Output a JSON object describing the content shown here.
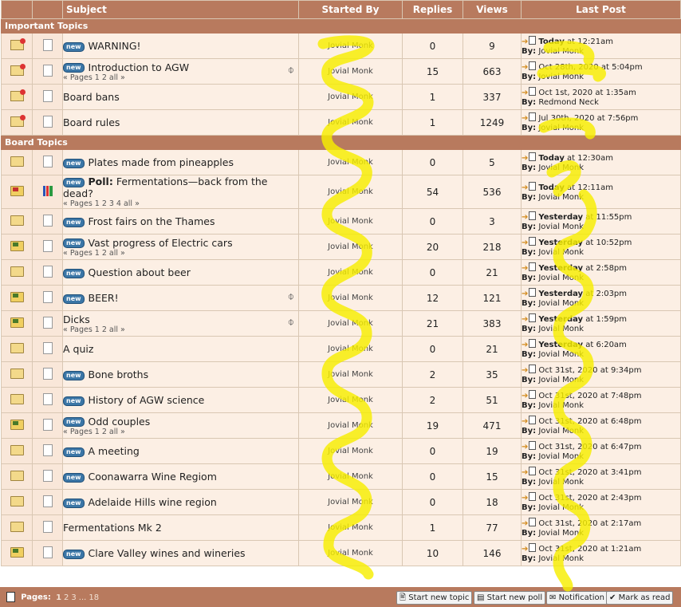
{
  "columns": {
    "subject": "Subject",
    "started_by": "Started By",
    "replies": "Replies",
    "views": "Views",
    "last_post": "Last Post"
  },
  "sections": [
    {
      "title": "Important Topics",
      "topics": [
        {
          "status": "locked",
          "new": true,
          "title": "WARNING!",
          "pages": null,
          "clip": false,
          "starter": "Jovial Monk",
          "replies": "0",
          "views": "9",
          "last_when": "Today",
          "last_rest": " at 12:21am",
          "last_by": "Jovial Monk",
          "when_bold": true
        },
        {
          "status": "locked",
          "new": true,
          "title": "Introduction to AGW",
          "pages": [
            "« Pages",
            "1",
            "2",
            "all",
            "»"
          ],
          "clip": true,
          "starter": "Jovial Monk",
          "replies": "15",
          "views": "663",
          "last_when": "Oct 28th, 2020",
          "last_rest": " at 5:04pm",
          "last_by": "Jovial Monk",
          "when_bold": false
        },
        {
          "status": "locked",
          "new": false,
          "title": "Board bans",
          "pages": null,
          "clip": false,
          "starter": "Jovial Monk",
          "replies": "1",
          "views": "337",
          "last_when": "Oct 1st, 2020",
          "last_rest": " at 1:35am",
          "last_by": "Redmond Neck",
          "when_bold": false
        },
        {
          "status": "locked",
          "new": false,
          "title": "Board rules",
          "pages": null,
          "clip": false,
          "starter": "Jovial Monk",
          "replies": "1",
          "views": "1249",
          "last_when": "Jul 30th, 2020",
          "last_rest": " at 7:56pm",
          "last_by": "Jovial Monk",
          "when_bold": false
        }
      ]
    },
    {
      "title": "Board Topics",
      "topics": [
        {
          "status": "folder",
          "new": true,
          "title": "Plates made from pineapples",
          "pages": null,
          "clip": false,
          "starter": "Jovial Monk",
          "replies": "0",
          "views": "5",
          "last_when": "Today",
          "last_rest": " at 12:30am",
          "last_by": "Jovial Monk",
          "when_bold": true
        },
        {
          "status": "hot-red",
          "poll": true,
          "new": true,
          "title": "Poll: Fermentations—back from the dead?",
          "pages": [
            "« Pages",
            "1",
            "2",
            "3",
            "4",
            "all",
            "»"
          ],
          "clip": false,
          "starter": "Jovial Monk",
          "replies": "54",
          "views": "536",
          "last_when": "Today",
          "last_rest": " at 12:11am",
          "last_by": "Jovial Monk",
          "when_bold": true
        },
        {
          "status": "folder",
          "new": true,
          "title": "Frost fairs on the Thames",
          "pages": null,
          "clip": false,
          "starter": "Jovial Monk",
          "replies": "0",
          "views": "3",
          "last_when": "Yesterday",
          "last_rest": " at 11:55pm",
          "last_by": "Jovial Monk",
          "when_bold": true
        },
        {
          "status": "hot",
          "new": true,
          "title": "Vast progress of Electric cars",
          "pages": [
            "« Pages",
            "1",
            "2",
            "all",
            "»"
          ],
          "clip": false,
          "starter": "Jovial Monk",
          "replies": "20",
          "views": "218",
          "last_when": "Yesterday",
          "last_rest": " at 10:52pm",
          "last_by": "Jovial Monk",
          "when_bold": true
        },
        {
          "status": "folder",
          "new": true,
          "title": "Question about beer",
          "pages": null,
          "clip": false,
          "starter": "Jovial Monk",
          "replies": "0",
          "views": "21",
          "last_when": "Yesterday",
          "last_rest": " at 2:58pm",
          "last_by": "Jovial Monk",
          "when_bold": true
        },
        {
          "status": "hot",
          "new": true,
          "title": "BEER!",
          "pages": null,
          "clip": true,
          "starter": "Jovial Monk",
          "replies": "12",
          "views": "121",
          "last_when": "Yesterday",
          "last_rest": " at 2:03pm",
          "last_by": "Jovial Monk",
          "when_bold": true
        },
        {
          "status": "hot",
          "new": false,
          "title": "Dicks",
          "pages": [
            "« Pages",
            "1",
            "2",
            "all",
            "»"
          ],
          "clip": true,
          "starter": "Jovial Monk",
          "replies": "21",
          "views": "383",
          "last_when": "Yesterday",
          "last_rest": " at 1:59pm",
          "last_by": "Jovial Monk",
          "when_bold": true
        },
        {
          "status": "folder",
          "new": false,
          "title": "A quiz",
          "pages": null,
          "clip": false,
          "starter": "Jovial Monk",
          "replies": "0",
          "views": "21",
          "last_when": "Yesterday",
          "last_rest": " at 6:20am",
          "last_by": "Jovial Monk",
          "when_bold": true
        },
        {
          "status": "folder",
          "new": true,
          "title": "Bone broths",
          "pages": null,
          "clip": false,
          "starter": "Jovial Monk",
          "replies": "2",
          "views": "35",
          "last_when": "Oct 31st, 2020",
          "last_rest": " at 9:34pm",
          "last_by": "Jovial Monk",
          "when_bold": false
        },
        {
          "status": "folder",
          "new": true,
          "title": "History of AGW science",
          "pages": null,
          "clip": false,
          "starter": "Jovial Monk",
          "replies": "2",
          "views": "51",
          "last_when": "Oct 31st, 2020",
          "last_rest": " at 7:48pm",
          "last_by": "Jovial Monk",
          "when_bold": false
        },
        {
          "status": "hot",
          "new": true,
          "title": "Odd couples",
          "pages": [
            "« Pages",
            "1",
            "2",
            "all",
            "»"
          ],
          "clip": false,
          "starter": "Jovial Monk",
          "replies": "19",
          "views": "471",
          "last_when": "Oct 31st, 2020",
          "last_rest": " at 6:48pm",
          "last_by": "Jovial Monk",
          "when_bold": false
        },
        {
          "status": "folder",
          "new": true,
          "title": "A meeting",
          "pages": null,
          "clip": false,
          "starter": "Jovial Monk",
          "replies": "0",
          "views": "19",
          "last_when": "Oct 31st, 2020",
          "last_rest": " at 6:47pm",
          "last_by": "Jovial Monk",
          "when_bold": false
        },
        {
          "status": "folder",
          "new": true,
          "title": "Coonawarra Wine Regiom",
          "pages": null,
          "clip": false,
          "starter": "Jovial Monk",
          "replies": "0",
          "views": "15",
          "last_when": "Oct 31st, 2020",
          "last_rest": " at 3:41pm",
          "last_by": "Jovial Monk",
          "when_bold": false
        },
        {
          "status": "folder",
          "new": true,
          "title": "Adelaide Hills wine region",
          "pages": null,
          "clip": false,
          "starter": "Jovial Monk",
          "replies": "0",
          "views": "18",
          "last_when": "Oct 31st, 2020",
          "last_rest": " at 2:43pm",
          "last_by": "Jovial Monk",
          "when_bold": false
        },
        {
          "status": "folder",
          "new": false,
          "title": "Fermentations Mk 2",
          "pages": null,
          "clip": false,
          "starter": "Jovial Monk",
          "replies": "1",
          "views": "77",
          "last_when": "Oct 31st, 2020",
          "last_rest": " at 2:17am",
          "last_by": "Jovial Monk",
          "when_bold": false
        },
        {
          "status": "hot",
          "new": true,
          "title": "Clare Valley wines and wineries",
          "pages": null,
          "clip": false,
          "starter": "Jovial Monk",
          "replies": "10",
          "views": "146",
          "last_when": "Oct 31st, 2020",
          "last_rest": " at 1:21am",
          "last_by": "Jovial Monk",
          "when_bold": false
        }
      ]
    }
  ],
  "labels": {
    "new_badge": "new",
    "by": "By:",
    "poll_prefix": "Poll:"
  },
  "footer": {
    "pages_label": "Pages:",
    "pages": [
      "1",
      "2",
      "3",
      "...",
      "18"
    ],
    "buttons": [
      "Start new topic",
      "Start new poll",
      "Notification",
      "Mark as read"
    ]
  },
  "colors": {
    "header": "#b87a5e",
    "row": "#fcefe4",
    "highlight": "#f6ee00",
    "badge": "#3b76a6"
  }
}
